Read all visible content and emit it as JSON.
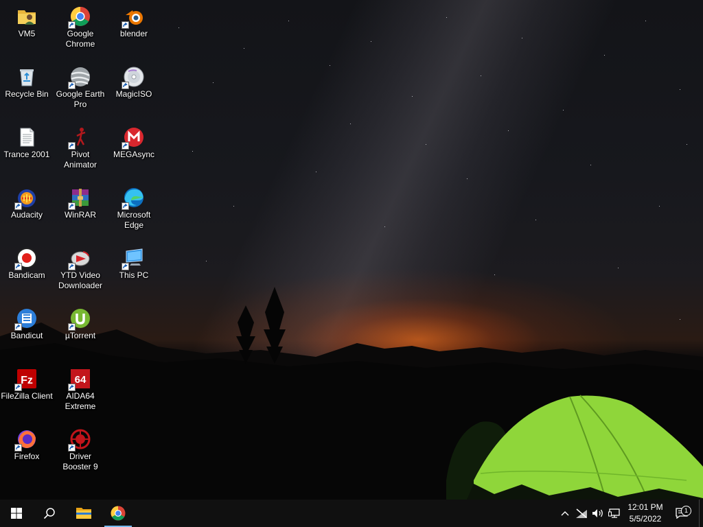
{
  "desktop": {
    "icons": [
      {
        "id": "vm5",
        "label": "VM5"
      },
      {
        "id": "chrome",
        "label": "Google Chrome"
      },
      {
        "id": "blender",
        "label": "blender"
      },
      {
        "id": "recycle",
        "label": "Recycle Bin"
      },
      {
        "id": "earth",
        "label": "Google Earth Pro"
      },
      {
        "id": "magiciso",
        "label": "MagicISO"
      },
      {
        "id": "trance",
        "label": "Trance 2001"
      },
      {
        "id": "pivot",
        "label": "Pivot Animator"
      },
      {
        "id": "megasync",
        "label": "MEGAsync"
      },
      {
        "id": "audacity",
        "label": "Audacity"
      },
      {
        "id": "winrar",
        "label": "WinRAR"
      },
      {
        "id": "edge",
        "label": "Microsoft Edge"
      },
      {
        "id": "bandicam",
        "label": "Bandicam"
      },
      {
        "id": "ytd",
        "label": "YTD Video Downloader"
      },
      {
        "id": "thispc",
        "label": "This PC"
      },
      {
        "id": "bandicut",
        "label": "Bandicut"
      },
      {
        "id": "utorrent",
        "label": "µTorrent"
      },
      {
        "id": "filezilla",
        "label": "FileZilla Client"
      },
      {
        "id": "aida64",
        "label": "AIDA64 Extreme"
      },
      {
        "id": "firefox",
        "label": "Firefox"
      },
      {
        "id": "driverbooster",
        "label": "Driver Booster 9"
      }
    ]
  },
  "taskbar": {
    "start_icon": "windows-start-icon",
    "search_icon": "search-icon",
    "pinned": [
      "file-explorer-icon",
      "chrome-icon"
    ],
    "tray_icons": [
      "chevron-up-icon",
      "network-disconnected-icon",
      "volume-icon",
      "display-icon"
    ],
    "clock": {
      "time": "12:01 PM",
      "date": "5/5/2022"
    },
    "notifications": {
      "count": "1"
    }
  },
  "colors": {
    "taskbar": "#101010",
    "active_underline": "#76b9ed",
    "tent": "#8fd63a",
    "horizon_glow": "#ff7a1e"
  }
}
